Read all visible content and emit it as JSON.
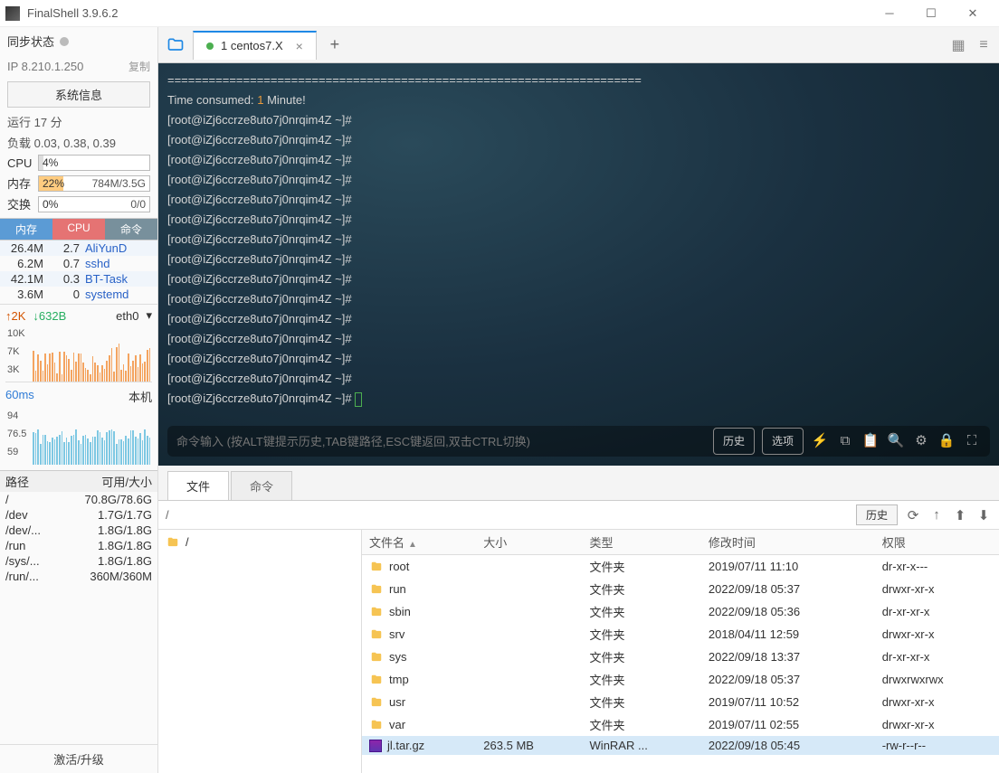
{
  "window": {
    "title": "FinalShell 3.9.6.2"
  },
  "sidebar": {
    "sync_label": "同步状态",
    "ip_prefix": "IP ",
    "ip": "8.210.1.250",
    "copy": "复制",
    "sysinfo_btn": "系统信息",
    "uptime": "运行 17 分",
    "load": "负载 0.03, 0.38, 0.39",
    "metrics": {
      "cpu_label": "CPU",
      "cpu_pct": "4%",
      "mem_label": "内存",
      "mem_pct": "22%",
      "mem_text": "784M/3.5G",
      "swap_label": "交换",
      "swap_pct": "0%",
      "swap_text": "0/0"
    },
    "proc_headers": {
      "mem": "内存",
      "cpu": "CPU",
      "cmd": "命令"
    },
    "procs": [
      {
        "mem": "26.4M",
        "cpu": "2.7",
        "cmd": "AliYunD"
      },
      {
        "mem": "6.2M",
        "cpu": "0.7",
        "cmd": "sshd"
      },
      {
        "mem": "42.1M",
        "cpu": "0.3",
        "cmd": "BT-Task"
      },
      {
        "mem": "3.6M",
        "cpu": "0",
        "cmd": "systemd"
      }
    ],
    "net": {
      "up": "↑2K",
      "down": "↓632B",
      "iface": "eth0"
    },
    "net_y": [
      "10K",
      "7K",
      "3K"
    ],
    "latency": {
      "value": "60ms",
      "host": "本机",
      "y": [
        "94",
        "76.5",
        "59"
      ]
    },
    "disk_headers": {
      "path": "路径",
      "size": "可用/大小"
    },
    "disks": [
      {
        "path": "/",
        "size": "70.8G/78.6G"
      },
      {
        "path": "/dev",
        "size": "1.7G/1.7G"
      },
      {
        "path": "/dev/...",
        "size": "1.8G/1.8G"
      },
      {
        "path": "/run",
        "size": "1.8G/1.8G"
      },
      {
        "path": "/sys/...",
        "size": "1.8G/1.8G"
      },
      {
        "path": "/run/...",
        "size": "360M/360M"
      }
    ],
    "activate": "激活/升级"
  },
  "tabs": {
    "main": "1 centos7.X"
  },
  "terminal": {
    "sep": "=====================================================================",
    "time_prefix": "Time consumed: ",
    "time_num": "1",
    "time_suffix": " Minute!",
    "prompt": "[root@iZj6ccrze8uto7j0nrqim4Z ~]#",
    "prompt_repeat": 14,
    "input_placeholder": "命令输入 (按ALT键提示历史,TAB键路径,ESC键返回,双击CTRL切换)",
    "history_btn": "历史",
    "options_btn": "选项"
  },
  "files": {
    "tab_file": "文件",
    "tab_cmd": "命令",
    "path": "/",
    "history_btn": "历史",
    "tree_root": "/",
    "headers": {
      "name": "文件名",
      "size": "大小",
      "type": "类型",
      "mtime": "修改时间",
      "perm": "权限"
    },
    "rows": [
      {
        "name": "root",
        "size": "",
        "type": "文件夹",
        "mtime": "2019/07/11 11:10",
        "perm": "dr-xr-x---",
        "kind": "folder"
      },
      {
        "name": "run",
        "size": "",
        "type": "文件夹",
        "mtime": "2022/09/18 05:37",
        "perm": "drwxr-xr-x",
        "kind": "folder"
      },
      {
        "name": "sbin",
        "size": "",
        "type": "文件夹",
        "mtime": "2022/09/18 05:36",
        "perm": "dr-xr-xr-x",
        "kind": "link"
      },
      {
        "name": "srv",
        "size": "",
        "type": "文件夹",
        "mtime": "2018/04/11 12:59",
        "perm": "drwxr-xr-x",
        "kind": "folder"
      },
      {
        "name": "sys",
        "size": "",
        "type": "文件夹",
        "mtime": "2022/09/18 13:37",
        "perm": "dr-xr-xr-x",
        "kind": "folder"
      },
      {
        "name": "tmp",
        "size": "",
        "type": "文件夹",
        "mtime": "2022/09/18 05:37",
        "perm": "drwxrwxrwx",
        "kind": "folder"
      },
      {
        "name": "usr",
        "size": "",
        "type": "文件夹",
        "mtime": "2019/07/11 10:52",
        "perm": "drwxr-xr-x",
        "kind": "folder"
      },
      {
        "name": "var",
        "size": "",
        "type": "文件夹",
        "mtime": "2019/07/11 02:55",
        "perm": "drwxr-xr-x",
        "kind": "folder"
      },
      {
        "name": "jl.tar.gz",
        "size": "263.5 MB",
        "type": "WinRAR ...",
        "mtime": "2022/09/18 05:45",
        "perm": "-rw-r--r--",
        "kind": "rar",
        "selected": true
      }
    ]
  }
}
